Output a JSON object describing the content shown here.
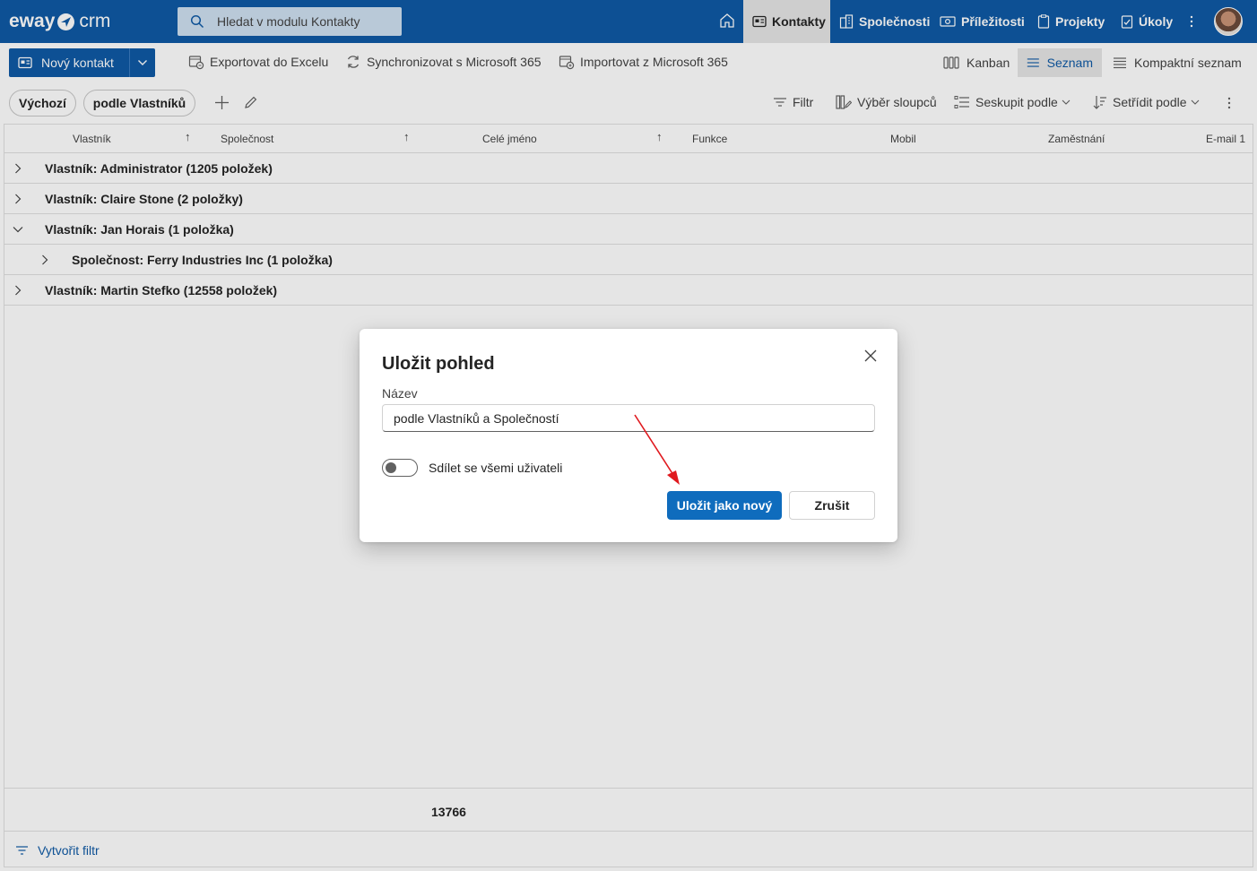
{
  "app": {
    "logo_left": "eway",
    "logo_right": "crm"
  },
  "search": {
    "placeholder": "Hledat v modulu Kontakty"
  },
  "nav": {
    "items": [
      {
        "label": "Kontakty",
        "icon": "contact-card-icon",
        "active": true
      },
      {
        "label": "Společnosti",
        "icon": "building-icon",
        "active": false
      },
      {
        "label": "Příležitosti",
        "icon": "money-icon",
        "active": false
      },
      {
        "label": "Projekty",
        "icon": "clipboard-icon",
        "active": false
      },
      {
        "label": "Úkoly",
        "icon": "task-icon",
        "active": false
      }
    ]
  },
  "commands": {
    "new_contact": "Nový kontakt",
    "export_excel": "Exportovat do Excelu",
    "sync_m365": "Synchronizovat s Microsoft 365",
    "import_m365": "Importovat z Microsoft 365",
    "views": {
      "kanban": "Kanban",
      "list": "Seznam",
      "compact": "Kompaktní seznam"
    }
  },
  "filterbar": {
    "pills": [
      "Výchozí",
      "podle Vlastníků"
    ],
    "filter": "Filtr",
    "columns": "Výběr sloupců",
    "group_by": "Seskupit podle",
    "sort_by": "Setřídit podle"
  },
  "grid": {
    "columns": [
      "Vlastník",
      "Společnost",
      "Celé jméno",
      "Funkce",
      "Mobil",
      "Zaměstnání",
      "E-mail 1"
    ],
    "groups": [
      {
        "label": "Vlastník: Administrator (1205 položek)",
        "expanded": false,
        "level": 0
      },
      {
        "label": "Vlastník: Claire Stone (2 položky)",
        "expanded": false,
        "level": 0
      },
      {
        "label": "Vlastník: Jan Horais (1 položka)",
        "expanded": true,
        "level": 0
      },
      {
        "label": "Společnost: Ferry Industries Inc (1 položka)",
        "expanded": false,
        "level": 1
      },
      {
        "label": "Vlastník: Martin Stefko (12558 položek)",
        "expanded": false,
        "level": 0
      }
    ],
    "total": "13766",
    "create_filter": "Vytvořit filtr"
  },
  "dialog": {
    "title": "Uložit pohled",
    "name_label": "Název",
    "name_value": "podle Vlastníků a Společností",
    "share_label": "Sdílet se všemi uživateli",
    "share_on": false,
    "save_as_new": "Uložit jako nový",
    "cancel": "Zrušit"
  },
  "colors": {
    "brand": "#0f5aa5",
    "primary_button": "#0f6cbd",
    "annotation": "#e0191e"
  }
}
